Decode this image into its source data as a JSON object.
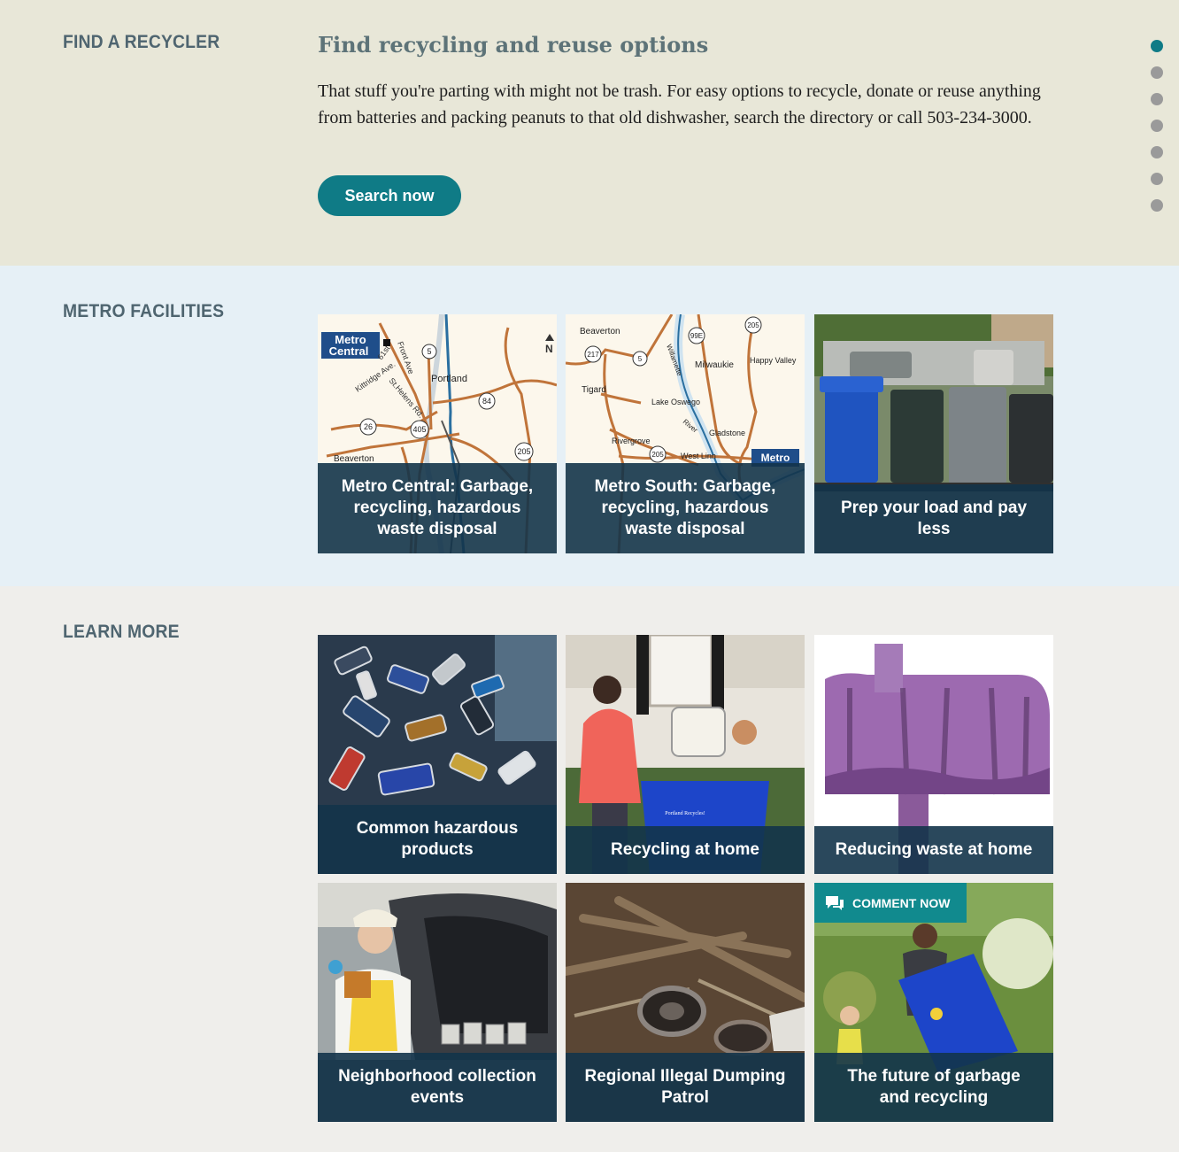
{
  "recycler": {
    "section_label": "FIND A RECYCLER",
    "headline": "Find recycling and reuse options",
    "intro": "That stuff you're parting with might not be trash. For easy options to recycle, donate or reuse anything from batteries and packing peanuts to that old dishwasher, search the directory or call 503-234-3000.",
    "button_label": "Search now"
  },
  "page_dots": {
    "count": 7,
    "active_index": 0
  },
  "facilities": {
    "section_label": "METRO FACILITIES",
    "cards": [
      {
        "title": "Metro Central: Garbage, recycling, hazardous waste disposal",
        "map_labels": {
          "badge_line1": "Metro",
          "badge_line2": "Central",
          "front_ave": "Front Ave",
          "st61": "61st",
          "kittridge": "Kittridge Ave.",
          "st_helens": "St.Helens Rd.",
          "portland": "Portland",
          "beaverton": "Beaverton",
          "north": "N",
          "i5": "5",
          "i84": "84",
          "i405": "405",
          "r26": "26",
          "i205": "205"
        }
      },
      {
        "title": "Metro South: Garbage, recycling, hazardous waste disposal",
        "map_labels": {
          "beaverton": "Beaverton",
          "tigard": "Tigard",
          "milwaukie": "Milwaukie",
          "happy_valley": "Happy Valley",
          "lake_oswego": "Lake Oswego",
          "willamette": "Willamette",
          "river": "River",
          "gladstone": "Gladstone",
          "rivergrove": "Rivergrove",
          "west_linn": "West Linn",
          "badge_line1": "Metro",
          "r99e": "99E",
          "r217": "217",
          "i5": "5",
          "i205a": "205",
          "i205b": "205"
        }
      },
      {
        "title": "Prep your load and pay less"
      }
    ]
  },
  "learn": {
    "section_label": "LEARN MORE",
    "badge_label": "COMMENT NOW",
    "cards": [
      {
        "title": "Common hazardous products"
      },
      {
        "title": "Recycling at home",
        "bin_text": "Portland Recycles!"
      },
      {
        "title": "Reducing waste at home"
      },
      {
        "title": "Neighborhood collection events"
      },
      {
        "title": "Regional Illegal Dumping Patrol"
      },
      {
        "title": "The future of garbage and recycling"
      }
    ]
  },
  "colors": {
    "accent": "#0f7b86",
    "caption_bg": "#13344a",
    "label": "#4f6570"
  },
  "icons": [
    "comment-bubble-icon"
  ]
}
